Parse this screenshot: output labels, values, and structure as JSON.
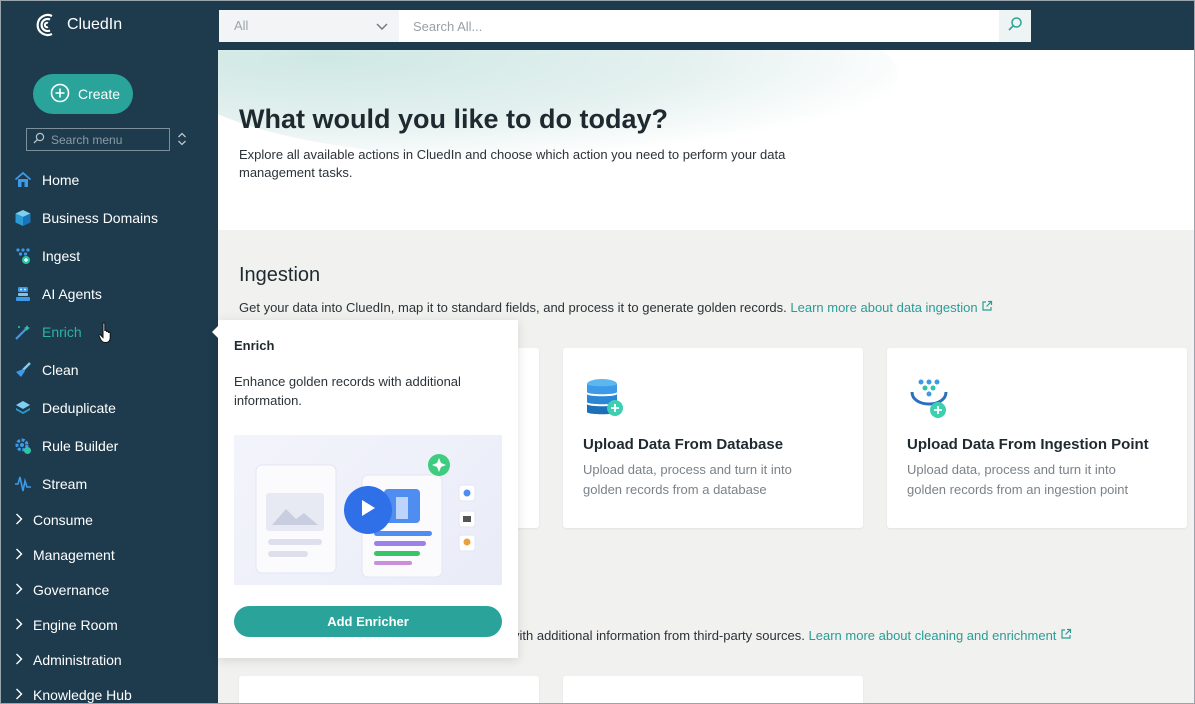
{
  "app": {
    "name": "CluedIn"
  },
  "search": {
    "scope": "All",
    "placeholder": "Search All..."
  },
  "sidebar": {
    "create_label": "Create",
    "menu_search_placeholder": "Search menu",
    "items": [
      {
        "label": "Home",
        "icon": "home-icon"
      },
      {
        "label": "Business Domains",
        "icon": "cube-icon"
      },
      {
        "label": "Ingest",
        "icon": "ingest-icon"
      },
      {
        "label": "AI Agents",
        "icon": "ai-agent-icon"
      },
      {
        "label": "Enrich",
        "icon": "wand-icon",
        "active": true
      },
      {
        "label": "Clean",
        "icon": "brush-icon"
      },
      {
        "label": "Deduplicate",
        "icon": "layers-icon"
      },
      {
        "label": "Rule Builder",
        "icon": "gear-icon"
      },
      {
        "label": "Stream",
        "icon": "stream-icon"
      }
    ],
    "groups": [
      {
        "label": "Consume"
      },
      {
        "label": "Management"
      },
      {
        "label": "Governance"
      },
      {
        "label": "Engine Room"
      },
      {
        "label": "Administration"
      },
      {
        "label": "Knowledge Hub"
      }
    ]
  },
  "hero": {
    "title": "What would you like to do today?",
    "description": "Explore all available actions in CluedIn and choose which action you need to perform your data management tasks."
  },
  "ingestion": {
    "title": "Ingestion",
    "description": "Get your data into CluedIn, map it to standard fields, and process it to generate golden records.",
    "link": "Learn more about data ingestion",
    "cards": [
      {
        "title": "Upload Data From Database",
        "description": "Upload data, process and turn it into golden records from a database"
      },
      {
        "title": "Upload Data From Ingestion Point",
        "description": "Upload data, process and turn it into golden records from an ingestion point"
      }
    ]
  },
  "enrichment": {
    "description_partial": "vith additional information from third-party sources.",
    "link": "Learn more about cleaning and enrichment"
  },
  "popover": {
    "title": "Enrich",
    "description": "Enhance golden records with additional information.",
    "button": "Add Enricher"
  },
  "colors": {
    "sidebar": "#1e3b4d",
    "accent": "#2aa39a",
    "active": "#2bb3a8",
    "link": "#2a9c95"
  }
}
